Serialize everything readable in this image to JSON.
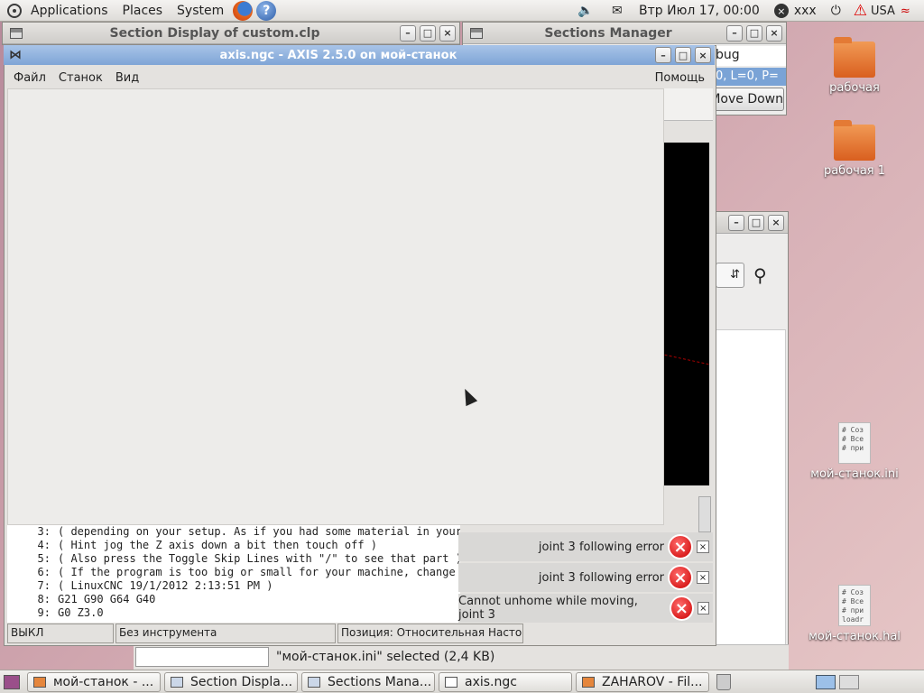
{
  "top_panel": {
    "menus": [
      "Applications",
      "Places",
      "System"
    ],
    "clock": "Втр Июл 17, 00:00",
    "user": "xxx",
    "keyboard_layout": "USA"
  },
  "windows": {
    "section_display": {
      "title": "Section Display of custom.clp"
    },
    "sections_manager": {
      "title": "Sections Manager",
      "fragment_text": "bug",
      "fragment_list": "0, L=0, P=",
      "move_down_label": "Move Down"
    },
    "axis": {
      "title": "axis.ngc - AXIS 2.5.0 on мой-станок",
      "menus": [
        "Файл",
        "Станок",
        "Вид"
      ],
      "help_menu": "Помощь",
      "gcode_lines": [
        {
          "n": "3:",
          "text": "( depending on your setup. As if you had some material in your mill... )"
        },
        {
          "n": "4:",
          "text": "( Hint jog the Z axis down a bit then touch off )"
        },
        {
          "n": "5:",
          "text": "( Also press the Toggle Skip Lines with \"/\" to see that part )"
        },
        {
          "n": "6:",
          "text": "( If the program is too big or small for your machine, change t"
        },
        {
          "n": "7:",
          "text": "( LinuxCNC 19/1/2012 2:13:51 PM )"
        },
        {
          "n": "8:",
          "text": "G21 G90 G64 G40"
        },
        {
          "n": "9:",
          "text": "G0 Z3.0"
        }
      ],
      "status": {
        "state": "ВЫКЛ",
        "tool": "Без инструмента",
        "position": "Позиция: Относительная Насто"
      }
    },
    "file_browser": {
      "selection_text": "\"мой-станок.ini\" selected (2,4 KB)"
    }
  },
  "notifications": [
    {
      "text": "joint 3 following error"
    },
    {
      "text": "joint 3 following error"
    },
    {
      "text": "Cannot unhome while moving, joint 3"
    }
  ],
  "desktop_icons": [
    {
      "label": "рабочая",
      "kind": "folder"
    },
    {
      "label": "рабочая 1",
      "kind": "folder"
    },
    {
      "label": "мой-станок.ini",
      "kind": "doc",
      "preview": "# Соз\n# Все\n# при"
    },
    {
      "label": "мой-станок.hal",
      "kind": "doc",
      "preview": "# Соз\n# Все\n# при\nloadr"
    }
  ],
  "taskbar": [
    {
      "label": "мой-станок - ..."
    },
    {
      "label": "Section Displa..."
    },
    {
      "label": "Sections Mana..."
    },
    {
      "label": "axis.ngc"
    },
    {
      "label": "ZAHAROV - Fil..."
    }
  ],
  "colors": {
    "accent_titlebar": "#7fa5d6",
    "error": "#cc0000",
    "desktop": "#c79aa6"
  },
  "icons": [
    "ubuntu-logo-icon",
    "firefox-icon",
    "help-icon",
    "volume-icon",
    "mail-icon",
    "user-status-icon",
    "power-icon",
    "warning-icon",
    "wifi-icon",
    "trash-icon",
    "show-desktop-icon"
  ]
}
